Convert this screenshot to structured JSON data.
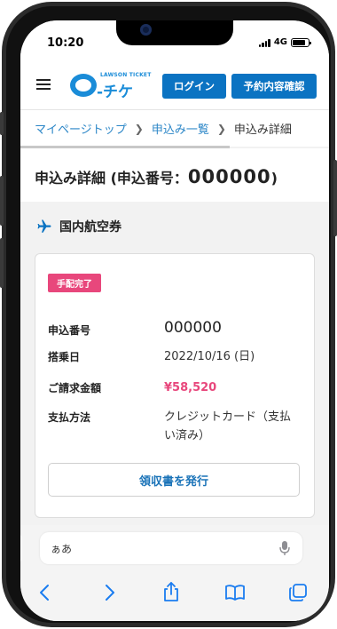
{
  "status_bar": {
    "time": "10:20",
    "network": "4G",
    "battery_level": 0.85
  },
  "header": {
    "logo_small": "LAWSON TICKET",
    "logo_text": "-チケ",
    "login_label": "ログイン",
    "reservation_label": "予約内容確認"
  },
  "breadcrumb": {
    "items": [
      "マイページトップ",
      "申込み一覧"
    ],
    "current": "申込み詳細"
  },
  "page": {
    "title_prefix": "申込み詳細 (申込番号：",
    "title_number": "000000",
    "title_suffix": ")"
  },
  "section": {
    "title": "国内航空券"
  },
  "card": {
    "status_badge": "手配完了",
    "rows": [
      {
        "label": "申込番号",
        "value": "000000"
      },
      {
        "label": "搭乗日",
        "value": "2022/10/16 (日)"
      },
      {
        "label": "ご請求金額",
        "value": "¥58,520"
      },
      {
        "label": "支払方法",
        "value": "クレジットカード（支払い済み）"
      }
    ],
    "receipt_button": "領収書を発行"
  },
  "keyboard": {
    "input_text": "ぁあ"
  },
  "colors": {
    "brand": "#1a8cd8",
    "button": "#0b73c2",
    "accent": "#e8477c",
    "link": "#2b86c7"
  }
}
